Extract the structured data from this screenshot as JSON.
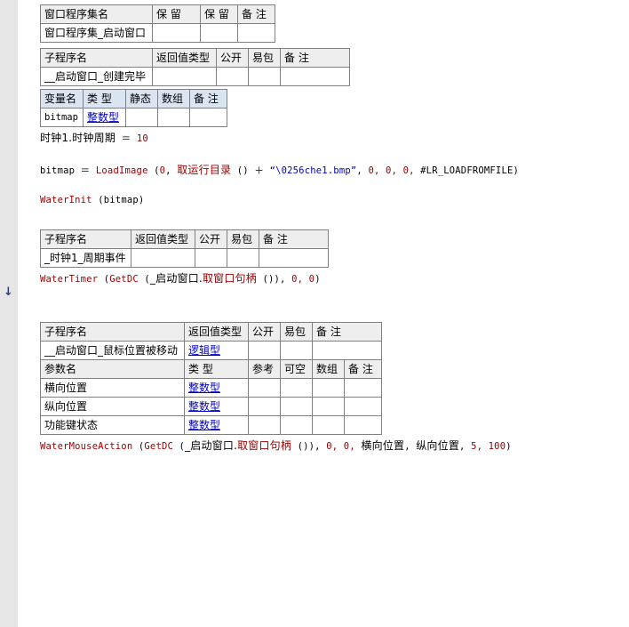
{
  "assembly_table": {
    "headers": [
      "窗口程序集名",
      "保 留",
      "保 留",
      "备 注"
    ],
    "row": [
      "窗口程序集_启动窗口",
      "",
      "",
      ""
    ]
  },
  "sub1": {
    "headers": [
      "子程序名",
      "返回值类型",
      "公开",
      "易包",
      "备 注"
    ],
    "row": [
      "__启动窗口_创建完毕",
      "",
      "",
      "",
      ""
    ]
  },
  "vars": {
    "headers": [
      "变量名",
      "类 型",
      "静态",
      "数组",
      "备 注"
    ],
    "row": [
      "bitmap",
      "整数型",
      "",
      "",
      ""
    ]
  },
  "code1": {
    "timer_obj": "时钟1.时钟周期",
    "eq": " ＝ ",
    "timer_val": "10",
    "bitmap_var": "bitmap",
    "fn_load": "LoadImage",
    "arg0": "0",
    "fn_rundir": "取运行目录",
    "plus": " ＋ ",
    "str_path": "“\\0256che1.bmp”",
    "args_tail": "0, 0, 0,",
    "const_flag": "#LR_LOADFROMFILE",
    "fn_init": "WaterInit",
    "init_arg": "bitmap"
  },
  "sub2": {
    "headers": [
      "子程序名",
      "返回值类型",
      "公开",
      "易包",
      "备 注"
    ],
    "row": [
      "_时钟1_周期事件",
      "",
      "",
      "",
      ""
    ]
  },
  "code2": {
    "fn_timer": "WaterTimer",
    "fn_getdc": "GetDC",
    "win": "_启动窗口.",
    "fn_handle": "取窗口句柄",
    "tail": "0, 0"
  },
  "sub3": {
    "headers": [
      "子程序名",
      "返回值类型",
      "公开",
      "易包",
      "备 注"
    ],
    "row": [
      "__启动窗口_鼠标位置被移动",
      "逻辑型",
      "",
      "",
      ""
    ],
    "param_headers": [
      "参数名",
      "类 型",
      "参考",
      "可空",
      "数组",
      "备 注"
    ],
    "params": [
      [
        "横向位置",
        "整数型"
      ],
      [
        "纵向位置",
        "整数型"
      ],
      [
        "功能键状态",
        "整数型"
      ]
    ]
  },
  "code3": {
    "fn_mouse": "WaterMouseAction",
    "fn_getdc": "GetDC",
    "win": "_启动窗口.",
    "fn_handle": "取窗口句柄",
    "mid": "0, 0,",
    "arg_x": "横向位置",
    "arg_y": "纵向位置",
    "tail": "5, 100"
  },
  "gutter_marker": "↓"
}
